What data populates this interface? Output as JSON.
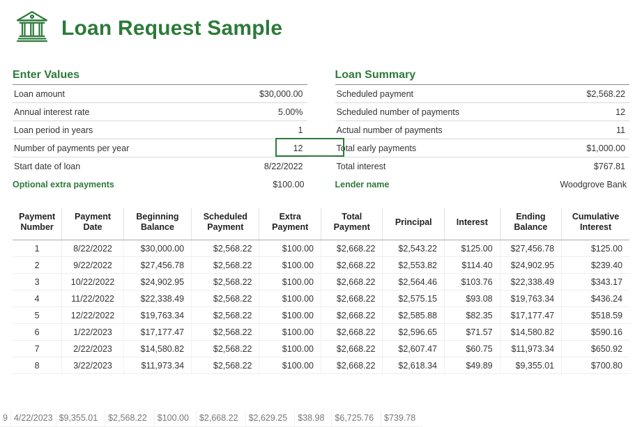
{
  "title": "Loan Request Sample",
  "sections": {
    "enter_values_title": "Enter Values",
    "loan_summary_title": "Loan Summary",
    "optional_label": "Optional extra payments",
    "optional_value": "$100.00",
    "lender_label": "Lender name",
    "lender_value": "Woodgrove Bank"
  },
  "enter_values": [
    {
      "label": "Loan amount",
      "value": "$30,000.00"
    },
    {
      "label": "Annual interest rate",
      "value": "5.00%"
    },
    {
      "label": "Loan period in years",
      "value": "1"
    },
    {
      "label": "Number of payments per year",
      "value": "12"
    },
    {
      "label": "Start date of loan",
      "value": "8/22/2022"
    }
  ],
  "loan_summary": [
    {
      "label": "Scheduled payment",
      "value": "$2,568.22"
    },
    {
      "label": "Scheduled number of payments",
      "value": "12"
    },
    {
      "label": "Actual number of payments",
      "value": "11"
    },
    {
      "label": "Total early payments",
      "value": "$1,000.00"
    },
    {
      "label": "Total interest",
      "value": "$767.81"
    }
  ],
  "columns": [
    "Payment Number",
    "Payment Date",
    "Beginning Balance",
    "Scheduled Payment",
    "Extra Payment",
    "Total Payment",
    "Principal",
    "Interest",
    "Ending Balance",
    "Cumulative Interest"
  ],
  "rows": [
    [
      "1",
      "8/22/2022",
      "$30,000.00",
      "$2,568.22",
      "$100.00",
      "$2,668.22",
      "$2,543.22",
      "$125.00",
      "$27,456.78",
      "$125.00"
    ],
    [
      "2",
      "9/22/2022",
      "$27,456.78",
      "$2,568.22",
      "$100.00",
      "$2,668.22",
      "$2,553.82",
      "$114.40",
      "$24,902.95",
      "$239.40"
    ],
    [
      "3",
      "10/22/2022",
      "$24,902.95",
      "$2,568.22",
      "$100.00",
      "$2,668.22",
      "$2,564.46",
      "$103.76",
      "$22,338.49",
      "$343.17"
    ],
    [
      "4",
      "11/22/2022",
      "$22,338.49",
      "$2,568.22",
      "$100.00",
      "$2,668.22",
      "$2,575.15",
      "$93.08",
      "$19,763.34",
      "$436.24"
    ],
    [
      "5",
      "12/22/2022",
      "$19,763.34",
      "$2,568.22",
      "$100.00",
      "$2,668.22",
      "$2,585.88",
      "$82.35",
      "$17,177.47",
      "$518.59"
    ],
    [
      "6",
      "1/22/2023",
      "$17,177.47",
      "$2,568.22",
      "$100.00",
      "$2,668.22",
      "$2,596.65",
      "$71.57",
      "$14,580.82",
      "$590.16"
    ],
    [
      "7",
      "2/22/2023",
      "$14,580.82",
      "$2,568.22",
      "$100.00",
      "$2,668.22",
      "$2,607.47",
      "$60.75",
      "$11,973.34",
      "$650.92"
    ],
    [
      "8",
      "3/22/2023",
      "$11,973.34",
      "$2,568.22",
      "$100.00",
      "$2,668.22",
      "$2,618.34",
      "$49.89",
      "$9,355.01",
      "$700.80"
    ],
    [
      "9",
      "4/22/2023",
      "$9,355.01",
      "$2,568.22",
      "$100.00",
      "$2,668.22",
      "$2,629.25",
      "$38.98",
      "$6,725.76",
      "$739.78"
    ]
  ]
}
